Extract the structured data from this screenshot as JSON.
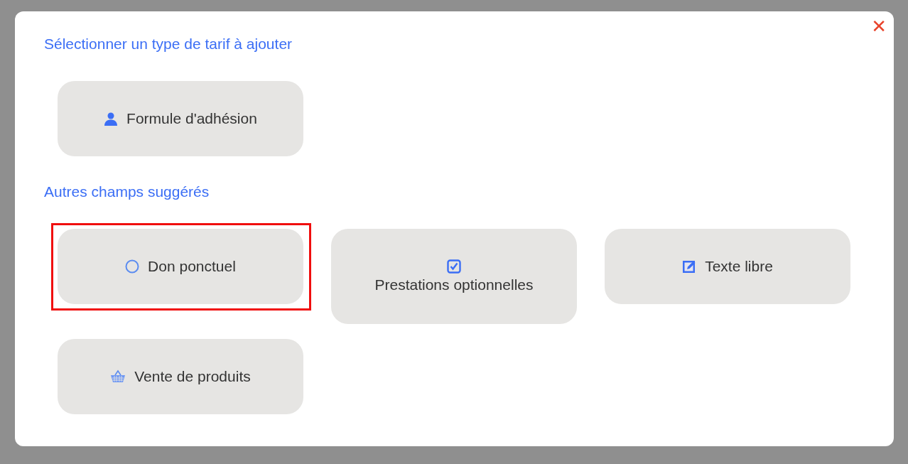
{
  "dialog": {
    "close_label": "✕",
    "sections": [
      {
        "title": "Sélectionner un type de tarif à ajouter",
        "options": [
          {
            "label": "Formule d'adhésion",
            "kind": "member",
            "highlighted": false
          }
        ]
      },
      {
        "title": "Autres champs suggérés",
        "options": [
          {
            "label": "Don ponctuel",
            "kind": "donation",
            "highlighted": true
          },
          {
            "label": "Prestations optionnelles",
            "kind": "checkbox",
            "highlighted": false
          },
          {
            "label": "Texte libre",
            "kind": "text",
            "highlighted": false
          },
          {
            "label": "Vente de produits",
            "kind": "shop",
            "highlighted": false
          }
        ]
      }
    ]
  }
}
